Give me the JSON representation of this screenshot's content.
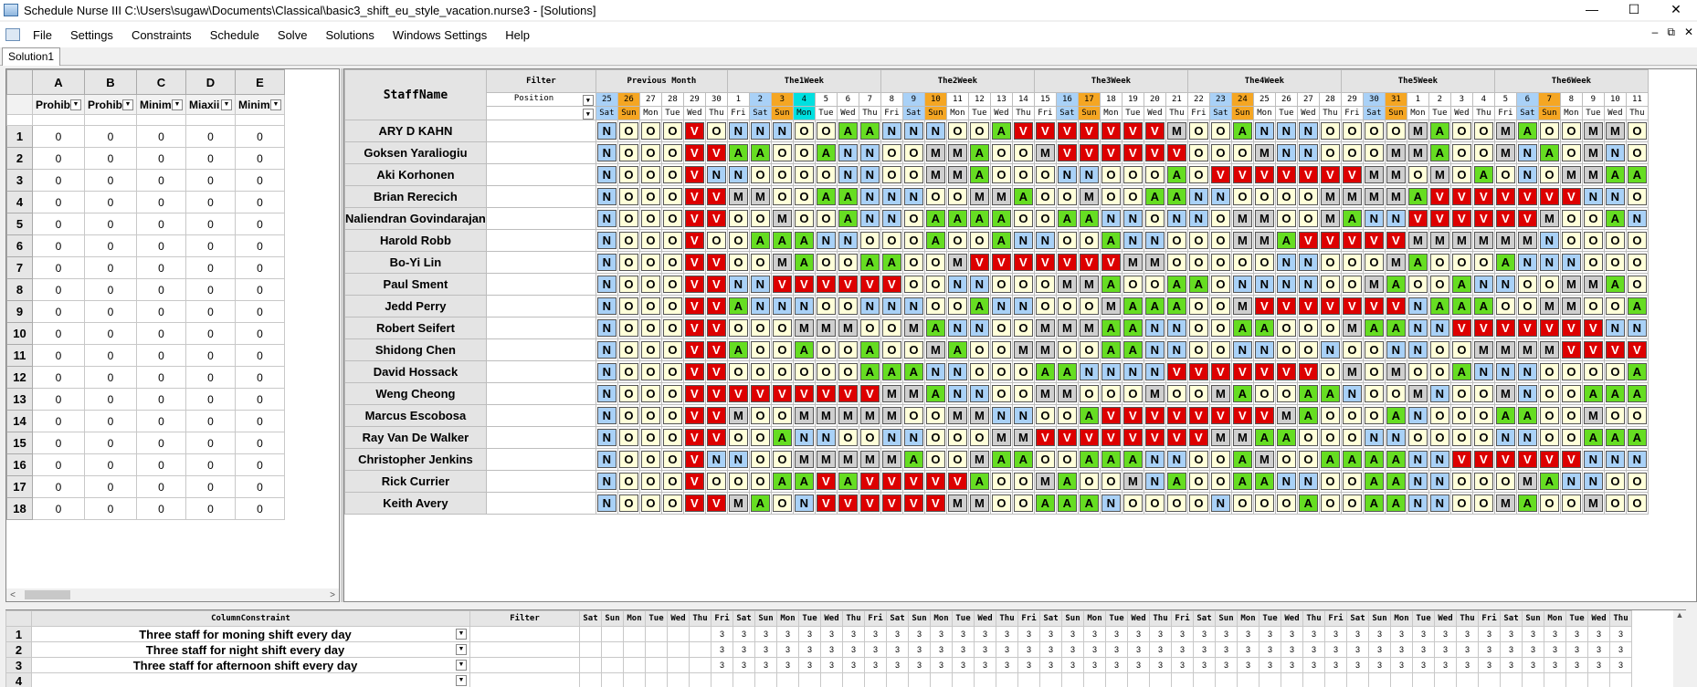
{
  "window": {
    "title": "Schedule Nurse III   C:\\Users\\sugaw\\Documents\\Classical\\basic3_shift_eu_style_vacation.nurse3 - [Solutions]",
    "minimize": "—",
    "maximize": "☐",
    "close": "✕",
    "mdi_min": "–",
    "mdi_restore": "⧉",
    "mdi_close": "✕"
  },
  "menu": [
    "File",
    "Settings",
    "Constraints",
    "Schedule",
    "Solve",
    "Solutions",
    "Windows Settings",
    "Help"
  ],
  "tab": "Solution1",
  "left_grid": {
    "cols": [
      "A",
      "B",
      "C",
      "D",
      "E"
    ],
    "filters": [
      "Prohib",
      "Prohib",
      "Minim",
      "Miaxii",
      "Minim"
    ],
    "rows": 18,
    "value": "0"
  },
  "schedule": {
    "staff_header": "StaffName",
    "filter_header": "Filter",
    "position_label": "Position",
    "weeks": [
      {
        "label": "Previous Month",
        "span": 6
      },
      {
        "label": "The1Week",
        "span": 7
      },
      {
        "label": "The2Week",
        "span": 7
      },
      {
        "label": "The3Week",
        "span": 7
      },
      {
        "label": "The4Week",
        "span": 7
      },
      {
        "label": "The5Week",
        "span": 7
      },
      {
        "label": "The6Week",
        "span": 7
      }
    ],
    "days": [
      "25",
      "26",
      "27",
      "28",
      "29",
      "30",
      "1",
      "2",
      "3",
      "4",
      "5",
      "6",
      "7",
      "8",
      "9",
      "10",
      "11",
      "12",
      "13",
      "14",
      "15",
      "16",
      "17",
      "18",
      "19",
      "20",
      "21",
      "22",
      "23",
      "24",
      "25",
      "26",
      "27",
      "28",
      "29",
      "30",
      "31",
      "1",
      "2",
      "3",
      "4",
      "5",
      "6",
      "7",
      "8",
      "9",
      "10",
      "11"
    ],
    "weekdays": [
      "Sat",
      "Sun",
      "Mon",
      "Tue",
      "Wed",
      "Thu",
      "Fri",
      "Sat",
      "Sun",
      "Mon",
      "Tue",
      "Wed",
      "Thu",
      "Fri",
      "Sat",
      "Sun",
      "Mon",
      "Tue",
      "Wed",
      "Thu",
      "Fri",
      "Sat",
      "Sun",
      "Mon",
      "Tue",
      "Wed",
      "Thu",
      "Fri",
      "Sat",
      "Sun",
      "Mon",
      "Tue",
      "Wed",
      "Thu",
      "Fri",
      "Sat",
      "Sun",
      "Mon",
      "Tue",
      "Wed",
      "Thu",
      "Fri",
      "Sat",
      "Sun",
      "Mon",
      "Tue",
      "Wed",
      "Thu"
    ],
    "day_colors": [
      "#a9d1f7",
      "#f5a623",
      "",
      "",
      "",
      "",
      "",
      "#a9d1f7",
      "#f5a623",
      "#00e0e0",
      "",
      "",
      "",
      "",
      "#a9d1f7",
      "#f5a623",
      "",
      "",
      "",
      "",
      "",
      "#a9d1f7",
      "#f5a623",
      "",
      "",
      "",
      "",
      "",
      "#a9d1f7",
      "#f5a623",
      "",
      "",
      "",
      "",
      "",
      "#a9d1f7",
      "#f5a623",
      "",
      "",
      "",
      "",
      "",
      "#a9d1f7",
      "#f5a623",
      "",
      "",
      "",
      ""
    ],
    "staff": [
      {
        "name": "ARY D KAHN",
        "shifts": "NOOOVONNNOOAANNNOOAVVVVVVVMOOANNNOOOOMAOOMAOOMM"
      },
      {
        "name": "Goksen Yaraliogiu",
        "shifts": "NOOOVVAAOOANNOOMMAOOMVVVVVVOOOMNNOOOMMAOOMNAOMNOO"
      },
      {
        "name": "Aki Korhonen",
        "shifts": "NOOOVNNOOOONNOOMMAOOONNOOOAOVVVVVVVMMOMOAONOMMAAO"
      },
      {
        "name": "Brian Rerecich",
        "shifts": "NOOOVVMMOOAANNNOOMMAOOMOOAANNOOOOMMMMAVVVVVVVNNOO"
      },
      {
        "name": "Naliendran Govindarajan",
        "shifts": "NOOOVVOOMOOANNOAAAAOOAANNONNOMMOOMANNVVVVVVMOOANN"
      },
      {
        "name": "Harold Robb",
        "shifts": "NOOOVOOAAANNOOOAOOANNOOANNOOOMMAVVVVVMMMMMMNOOOO"
      },
      {
        "name": "Bo-Yi Lin",
        "shifts": "NOOOVVOOMAOOAAOOMVVVVVVVMMOOOOONNOOOMAOOOANNNOOOO"
      },
      {
        "name": "Paul Sment",
        "shifts": "NOOOVVNNVVVVVVOONNOOOMMAOOAAONNNNOOMAOOANNOOMMA"
      },
      {
        "name": "Jedd Perry",
        "shifts": "NOOOVVANNNOONNNOOANNOOOMAAAOOMVVVVVVVNAAAOOMMOOA"
      },
      {
        "name": "Robert Seifert",
        "shifts": "NOOOVVOOOMMMOOMANNOOMMMAANNOOAAOOOMAANNVVVVVVVNN"
      },
      {
        "name": "Shidong Chen",
        "shifts": "NOOOVVAOOAOOAOOMAOOMMOOAANNOONNOONOONNOOMMMMVVVVVVN"
      },
      {
        "name": "David Hossack",
        "shifts": "NOOOVVOOOOOOAAANNOOOAANNNNVVVVVVVOMOMOOANNNOOOOA"
      },
      {
        "name": "Weng Cheong",
        "shifts": "NOOOVVVVVVVVVMMANNOOMMOOOMOOMAOOAANOOMNOOMNOOAAAO"
      },
      {
        "name": "Marcus Escobosa",
        "shifts": "NOOOVVMOOMMMMMOOMMNNOOAVVVVVVVVMAOOOANOOOAAOOMOO"
      },
      {
        "name": "Ray Van De Walker",
        "shifts": "NOOOVVOOANNOONNOOOMMVVVVVVVVMMAAOOONNOOOONNOOAAA"
      },
      {
        "name": "Christopher Jenkins",
        "shifts": "NOOOVNNOOMMMMMAOOMAAOOAAANNOOAMOOAAAANNVVVVVVNNNO"
      },
      {
        "name": "Rick Currier",
        "shifts": "NOOOVOOOAAVAVVVVVAOOMAOOMNAOOAANNOOAANNOOOMANNOO"
      },
      {
        "name": "Keith Avery",
        "shifts": "NOOOVVMAONVVVVVVMMOOAAANOOOONOOOAOOAANNOOMAOOM"
      }
    ]
  },
  "constraints": {
    "header": "ColumnConstraint",
    "filter_header": "Filter",
    "rows": [
      {
        "label": "Three staff for moning shift every day"
      },
      {
        "label": "Three staff for night shift every day"
      },
      {
        "label": "Three staff for afternoon shift every day"
      },
      {
        "label": ""
      }
    ],
    "value": "3"
  }
}
